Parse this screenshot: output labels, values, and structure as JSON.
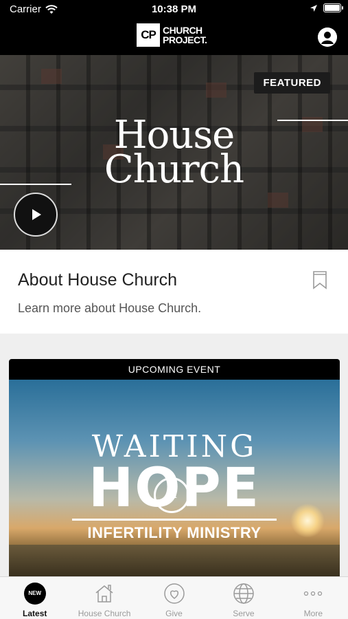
{
  "status_bar": {
    "carrier": "Carrier",
    "time": "10:38 PM"
  },
  "header": {
    "logo_mark": "CP",
    "logo_line1": "CHURCH",
    "logo_line2": "PROJECT.",
    "profile_icon": "person-circle-icon"
  },
  "featured": {
    "badge": "FEATURED",
    "title_line1": "House",
    "title_line2": "Church",
    "play_icon": "play-icon"
  },
  "about": {
    "title": "About House Church",
    "description": "Learn more about House Church.",
    "bookmark_icon": "bookmark-icon"
  },
  "event": {
    "header": "UPCOMING EVENT",
    "title_line1": "WAITING",
    "title_word": "HOPE",
    "title_in": "in",
    "subtitle": "INFERTILITY MINISTRY"
  },
  "tabs": [
    {
      "label": "Latest",
      "icon": "new-badge-icon",
      "badge": "NEW",
      "active": true
    },
    {
      "label": "House Church",
      "icon": "house-icon",
      "active": false
    },
    {
      "label": "Give",
      "icon": "heart-circle-icon",
      "active": false
    },
    {
      "label": "Serve",
      "icon": "globe-icon",
      "active": false
    },
    {
      "label": "More",
      "icon": "more-dots-icon",
      "active": false
    }
  ],
  "colors": {
    "header_bg": "#000000",
    "card_bg": "#ffffff",
    "page_bg": "#efefef",
    "tab_active": "#111111",
    "tab_inactive": "#9a9a9a"
  }
}
